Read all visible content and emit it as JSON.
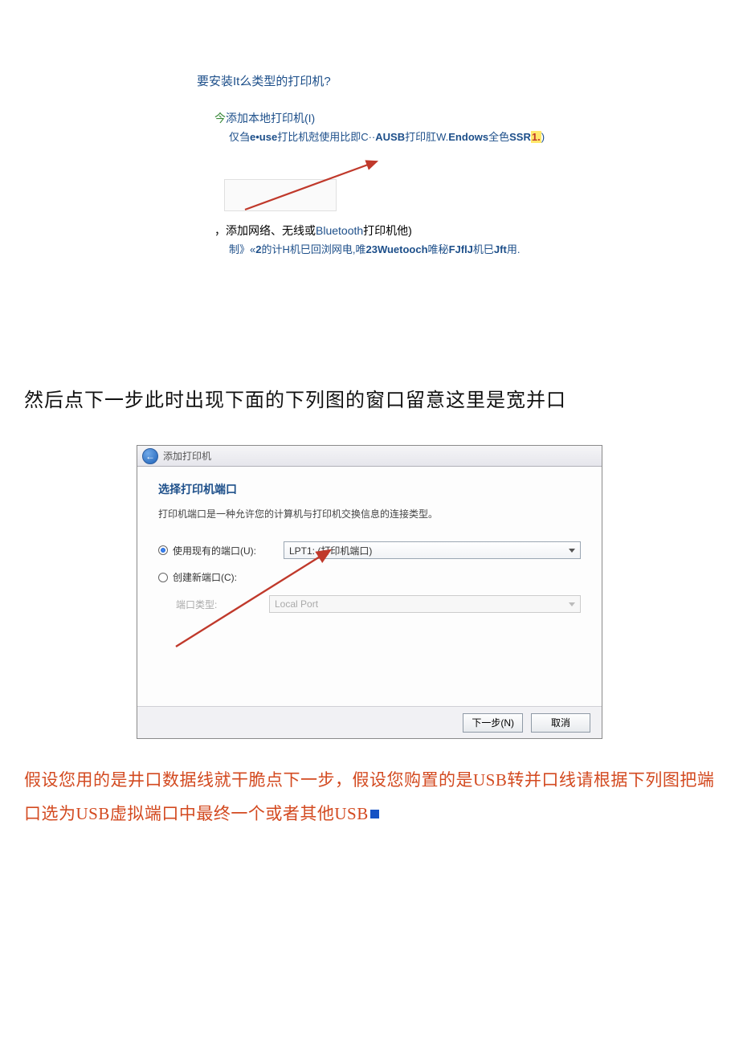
{
  "block1": {
    "question": "要安装It么类型的打印机?",
    "opt1": {
      "prefix": "今",
      "title_rest": "添加本地打印机(I)",
      "desc_pre": "仅刍",
      "desc_b1": "e•use",
      "desc_mid1": "打比机尅使用比即C··",
      "desc_b2": "AUSB",
      "desc_mid2": "打印肛W.",
      "desc_b3": "Endows",
      "desc_mid3": "全色",
      "desc_b4": "SSR",
      "desc_hl": "1.",
      "desc_tail": ")"
    },
    "opt2": {
      "lead": "，添加网络、无线或",
      "bold": "Bluetooth",
      "tail": "打印机他)",
      "desc_pre": "制》«",
      "desc_b1": "2",
      "desc_mid1": "的计H机巳回浏网电,唯",
      "desc_b2": "23Wuetooch",
      "desc_mid2": "唯秘",
      "desc_b3": "FJflJ",
      "desc_mid3": "机巳",
      "desc_b4": "Jft",
      "desc_tail": "用."
    }
  },
  "para1": "然后点下一步此时出现下面的下列图的窗口留意这里是宽并口",
  "dialog": {
    "back_glyph": "←",
    "title": "添加打印机",
    "heading": "选择打印机端口",
    "sub": "打印机端口是一种允许您的计算机与打印机交换信息的连接类型。",
    "row1_label": "使用现有的端口(U):",
    "row1_value": "LPT1: (打印机端口)",
    "row2_label": "创建新端口(C):",
    "row2_sublabel": "端口类型:",
    "row2_value": "Local Port",
    "btn_next": "下一步(N)",
    "btn_cancel": "取消"
  },
  "para2": {
    "t": "假设您用的是井口数据线就干脆点下一步，假设您购置的是USB转并口线请根据下列图把端口选为USB虚拟端口中最终一个或者其他USB"
  }
}
